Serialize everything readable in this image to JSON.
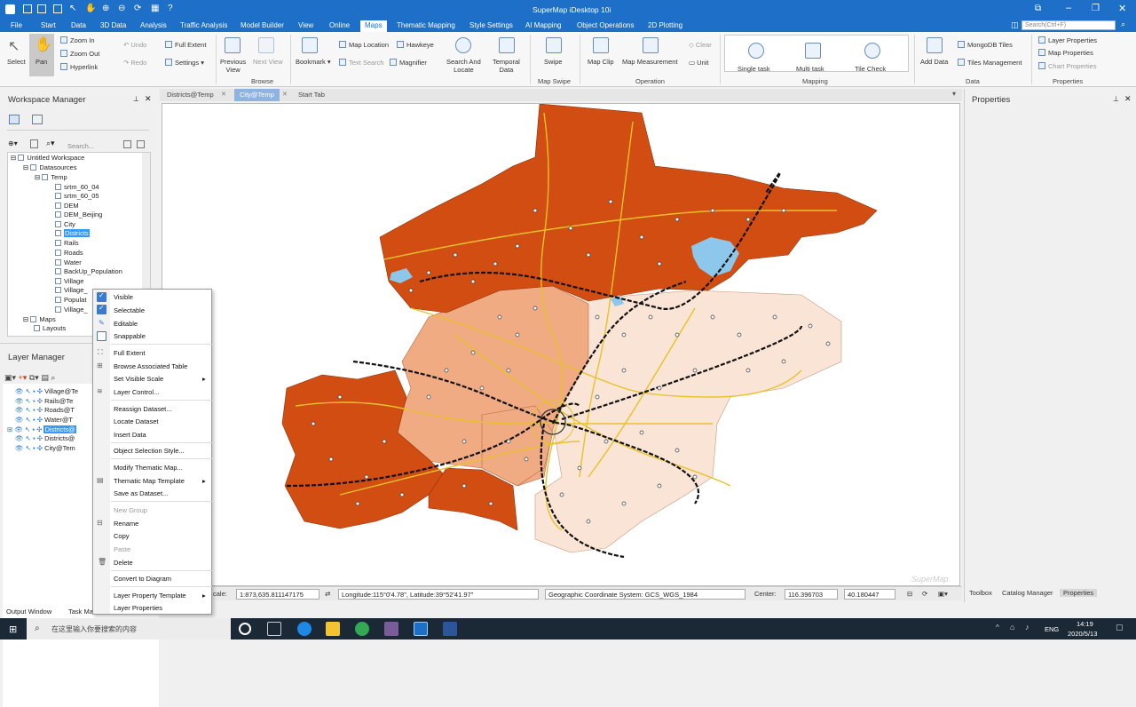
{
  "titlebar": {
    "app_title": "SuperMap iDesktop 10i"
  },
  "quick_search": {
    "placeholder": "Search(Ctrl+F)"
  },
  "menu": [
    "File",
    "Start",
    "Data",
    "3D Data",
    "Analysis",
    "Traffic Analysis",
    "Model Builder",
    "View",
    "Online",
    "Maps",
    "Thematic Mapping",
    "Style Settings",
    "AI Mapping",
    "Object Operations",
    "2D Plotting"
  ],
  "ribbon": {
    "select": "Select",
    "pan": "Pan",
    "zoom_in": "Zoom In",
    "zoom_out": "Zoom Out",
    "hyperlink": "Hyperlink",
    "undo": "Undo",
    "redo": "Redo",
    "full_extent": "Full Extent",
    "settings": "Settings",
    "previous_view": "Previous\nView",
    "next_view": "Next View",
    "bookmark": "Bookmark",
    "map_location": "Map Location",
    "text_search": "Text Search",
    "hawkeye": "Hawkeye",
    "magnifier": "Magnifier",
    "search_locate": "Search And\nLocate",
    "temporal_data": "Temporal\nData",
    "swipe": "Swipe",
    "map_clip": "Map Clip",
    "map_measurement": "Map Measurement",
    "clear": "Clear",
    "unit": "Unit",
    "single_task": "Single task",
    "multi_task": "Multi task",
    "tile_check": "Tile Check",
    "add_data": "Add Data",
    "mongodb_tiles": "MongoDB Tiles",
    "tiles_management": "Tiles Management",
    "layer_properties": "Layer Properties",
    "map_properties": "Map Properties",
    "chart_properties": "Chart Properties",
    "groups": {
      "browse": "Browse",
      "map_swipe": "Map Swipe",
      "operation": "Operation",
      "mapping": "Mapping",
      "data": "Data",
      "properties": "Properties"
    }
  },
  "workspace": {
    "title": "Workspace Manager",
    "search_placeholder": "Search...",
    "items": [
      "Untitled Workspace",
      "Datasources",
      "Temp",
      "srtm_60_04",
      "srtm_60_05",
      "DEM",
      "DEM_Beijing",
      "City",
      "Districts",
      "Rails",
      "Roads",
      "Water",
      "BackUp_Population",
      "Village",
      "Village_",
      "Populat",
      "Village_",
      "Maps",
      "Layouts"
    ]
  },
  "layers": {
    "title": "Layer Manager",
    "items": [
      "Village@Te",
      "Rails@Te",
      "Roads@T",
      "Water@T",
      "Districts@",
      "Districts@",
      "City@Tem"
    ]
  },
  "map_tabs": [
    "Districts@Temp",
    "City@Temp",
    "Start Tab"
  ],
  "context_menu": {
    "items": [
      "Visible",
      "Selectable",
      "Editable",
      "Snappable",
      "Full Extent",
      "Browse Associated Table",
      "Set Visible Scale",
      "Layer Control...",
      "Reassign Dataset...",
      "Locate Dataset",
      "Insert Data",
      "Object Selection Style...",
      "Modify Thematic Map...",
      "Thematic Map Template",
      "Save as Dataset...",
      "New Group",
      "Rename",
      "Copy",
      "Paste",
      "Delete",
      "Convert to Diagram",
      "Layer Property Template",
      "Layer Properties"
    ]
  },
  "statusbar": {
    "scale_label": "cale:",
    "scale_value": "1:873,635.811147175",
    "coords": "Longitude:115°0'4.78\", Latitude:39°52'41.97\"",
    "crs": "Geographic Coordinate System: GCS_WGS_1984",
    "center_label": "Center:",
    "center_x": "116.396703",
    "center_y": "40.180447"
  },
  "properties_panel": {
    "title": "Properties"
  },
  "right_tabs": [
    "Toolbox",
    "Catalog Manager",
    "Properties"
  ],
  "bottom_tabs": [
    "Output Window",
    "Task Ma"
  ],
  "watermark": "SuperMap",
  "taskbar": {
    "search_placeholder": "在这里输入你要搜索的内容",
    "language": "ENG",
    "time": "14:19",
    "date": "2020/5/13"
  },
  "colors": {
    "accent": "#1e6fc7",
    "district_dark": "#d24d12",
    "district_mid": "#f0ab83",
    "district_light": "#f9e4d5",
    "road": "#e8c22a",
    "water": "#8dc7ec"
  }
}
